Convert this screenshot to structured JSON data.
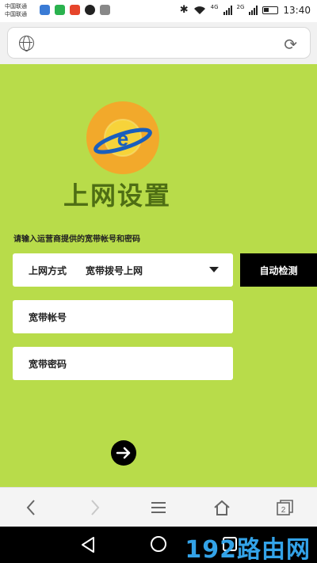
{
  "status_bar": {
    "carrier_line1": "中国联通",
    "carrier_line2": "中国联通",
    "net1": "4G",
    "net2": "2G",
    "time": "13:40"
  },
  "address_bar": {
    "url": "",
    "globe_icon": "globe-icon",
    "reload_icon": "reload-icon"
  },
  "page": {
    "title": "上网设置",
    "hint": "请输入运营商提供的宽带帐号和密码",
    "connection": {
      "label": "上网方式",
      "value": "宽带拨号上网"
    },
    "detect_button": "自动检测",
    "account_placeholder": "宽带帐号",
    "password_placeholder": "宽带密码",
    "colors": {
      "background": "#b8dc4a",
      "title": "#4e6e14",
      "logo": "#f2a92b"
    }
  },
  "browser_toolbar": {
    "items": [
      "back-icon",
      "forward-icon",
      "menu-icon",
      "home-icon",
      "tabs-icon"
    ],
    "tab_count": "2"
  },
  "watermark": "192路由网"
}
